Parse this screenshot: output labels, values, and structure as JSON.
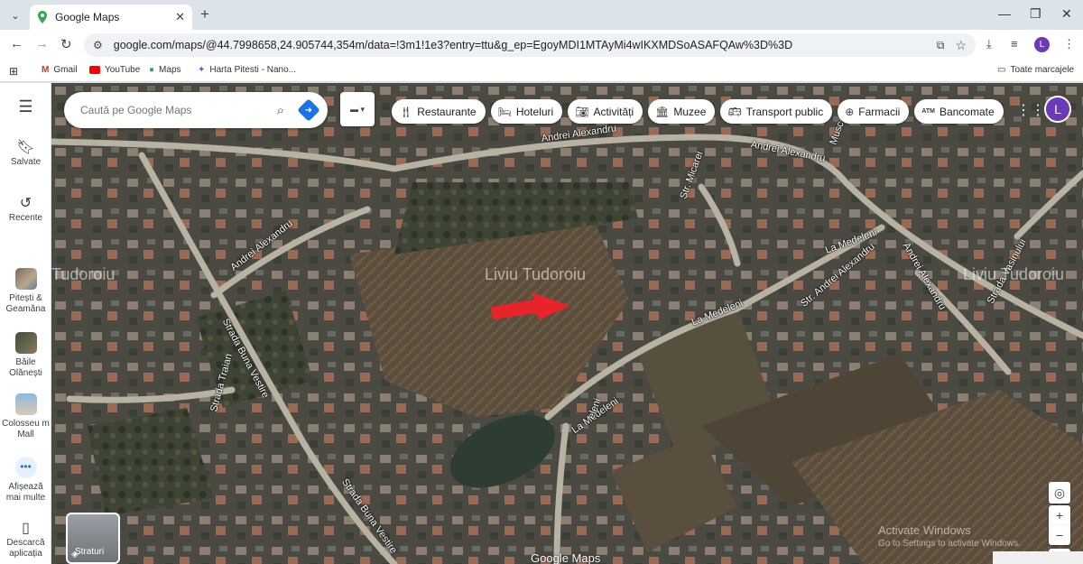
{
  "browser": {
    "tab_title": "Google Maps",
    "url": "google.com/maps/@44.7998658,24.905744,354m/data=!3m1!1e3?entry=ttu&g_ep=EgoyMDI1MTAyMi4wIKXMDSoASAFQAw%3D%3D",
    "bookmarks": [
      "Gmail",
      "YouTube",
      "Maps",
      "Harta Pitesti - Nano..."
    ],
    "all_bookmarks": "Toate marcajele",
    "profile_letter": "L"
  },
  "rail": {
    "saved": "Salvate",
    "recent": "Recente",
    "place1": "Pitești & Geamăna",
    "place2": "Băile Olănești",
    "place3": "Colosseu m Mall",
    "more": "Afișează mai multe",
    "download": "Descarcă aplicația"
  },
  "search": {
    "placeholder": "Caută pe Google Maps"
  },
  "chips": [
    "Restaurante",
    "Hoteluri",
    "Activități",
    "Muzee",
    "Transport public",
    "Farmacii",
    "Bancomate"
  ],
  "map": {
    "streets": {
      "andrei_top_left": "Andrei Alexandru",
      "andrei_top_right": "Andrei Alexandru",
      "andrei_left": "Andrei Alexandru",
      "andrei_right": "Andrei Alexandru",
      "buna_vestire_1": "Strada Buna Vestire",
      "buna_vestire_2": "Strada Buna Vestire",
      "traian": "Strada Traian",
      "micarei": "Str. Micarei",
      "la_medeleni_1": "La Medeleni",
      "la_medeleni_2": "La Medeleni",
      "la_medeleni_3": "La Medeleni",
      "str_andrei": "Str. Andrei Alexandru",
      "vasinului": "Strada Vasinului",
      "musc": "Musc",
      "eleni": "eleni"
    },
    "watermarks": [
      "Tudoroiu",
      "Liviu Tudoroiu",
      "Liviu Tudoroiu"
    ],
    "layers_label": "Straturi",
    "brand": "Google Maps",
    "activate_line1": "Activate Windows",
    "activate_line2": "Go to Settings to activate Windows."
  }
}
